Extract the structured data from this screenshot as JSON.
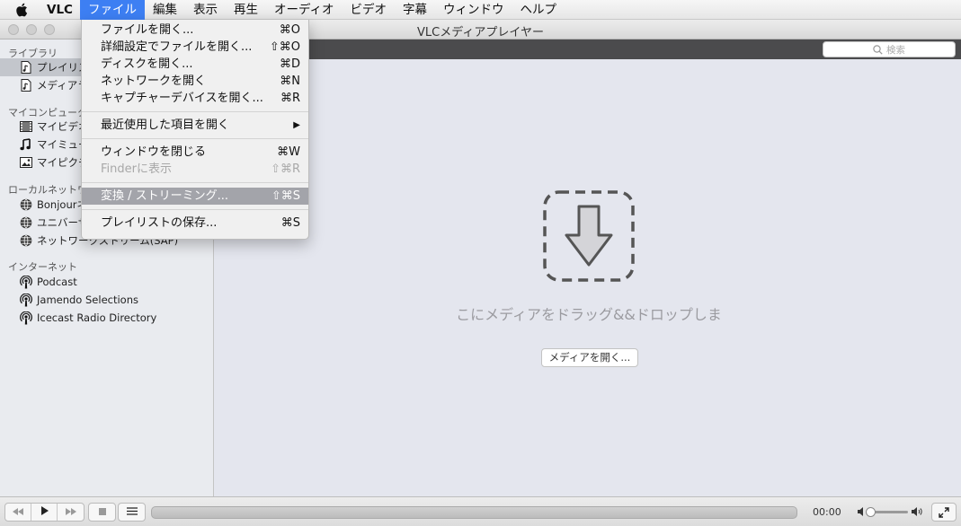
{
  "menubar": {
    "app_name": "VLC",
    "items": [
      "ファイル",
      "編集",
      "表示",
      "再生",
      "オーディオ",
      "ビデオ",
      "字幕",
      "ウィンドウ",
      "ヘルプ"
    ],
    "active_index": 0
  },
  "window": {
    "title": "VLCメディアプレイヤー"
  },
  "file_menu": {
    "groups": [
      [
        {
          "label": "ファイルを開く...",
          "shortcut": "⌘O"
        },
        {
          "label": "詳細設定でファイルを開く...",
          "shortcut": "⇧⌘O"
        },
        {
          "label": "ディスクを開く...",
          "shortcut": "⌘D"
        },
        {
          "label": "ネットワークを開く",
          "shortcut": "⌘N"
        },
        {
          "label": "キャプチャーデバイスを開く...",
          "shortcut": "⌘R"
        }
      ],
      [
        {
          "label": "最近使用した項目を開く",
          "shortcut": "▶"
        }
      ],
      [
        {
          "label": "ウィンドウを閉じる",
          "shortcut": "⌘W"
        },
        {
          "label": "Finderに表示",
          "shortcut": "⇧⌘R",
          "disabled": true
        }
      ],
      [
        {
          "label": "変換 / ストリーミング...",
          "shortcut": "⇧⌘S",
          "highlighted": true
        }
      ],
      [
        {
          "label": "プレイリストの保存...",
          "shortcut": "⌘S"
        }
      ]
    ]
  },
  "sidebar": {
    "sections": [
      {
        "header": "ライブラリ",
        "items": [
          {
            "label": "プレイリスト",
            "icon": "playlist-file-icon",
            "selected": true
          },
          {
            "label": "メディアライブラリ",
            "icon": "media-library-file-icon"
          }
        ]
      },
      {
        "header": "マイコンピューター",
        "items": [
          {
            "label": "マイビデオ",
            "icon": "film-icon"
          },
          {
            "label": "マイミュージック",
            "icon": "music-note-icon"
          },
          {
            "label": "マイピクチャ",
            "icon": "picture-icon"
          }
        ]
      },
      {
        "header": "ローカルネットワーク",
        "items": [
          {
            "label": "Bonjourネットワーク",
            "icon": "network-globe-icon"
          },
          {
            "label": "ユニバーサルプラグアンドプレイ",
            "icon": "network-globe-icon"
          },
          {
            "label": "ネットワークストリーム(SAP)",
            "icon": "network-globe-icon"
          }
        ]
      },
      {
        "header": "インターネット",
        "items": [
          {
            "label": "Podcast",
            "icon": "podcast-icon"
          },
          {
            "label": "Jamendo Selections",
            "icon": "podcast-icon"
          },
          {
            "label": "Icecast Radio Directory",
            "icon": "podcast-icon"
          }
        ]
      }
    ]
  },
  "search": {
    "placeholder": "検索"
  },
  "content": {
    "drop_text": "こにメディアをドラッグ&&ドロップしま",
    "open_media_button": "メディアを開く..."
  },
  "player": {
    "time": "00:00",
    "volume": 0.0
  },
  "colors": {
    "menu_highlight": "#a3a4aa",
    "menubar_active": "#3d7ff3"
  }
}
